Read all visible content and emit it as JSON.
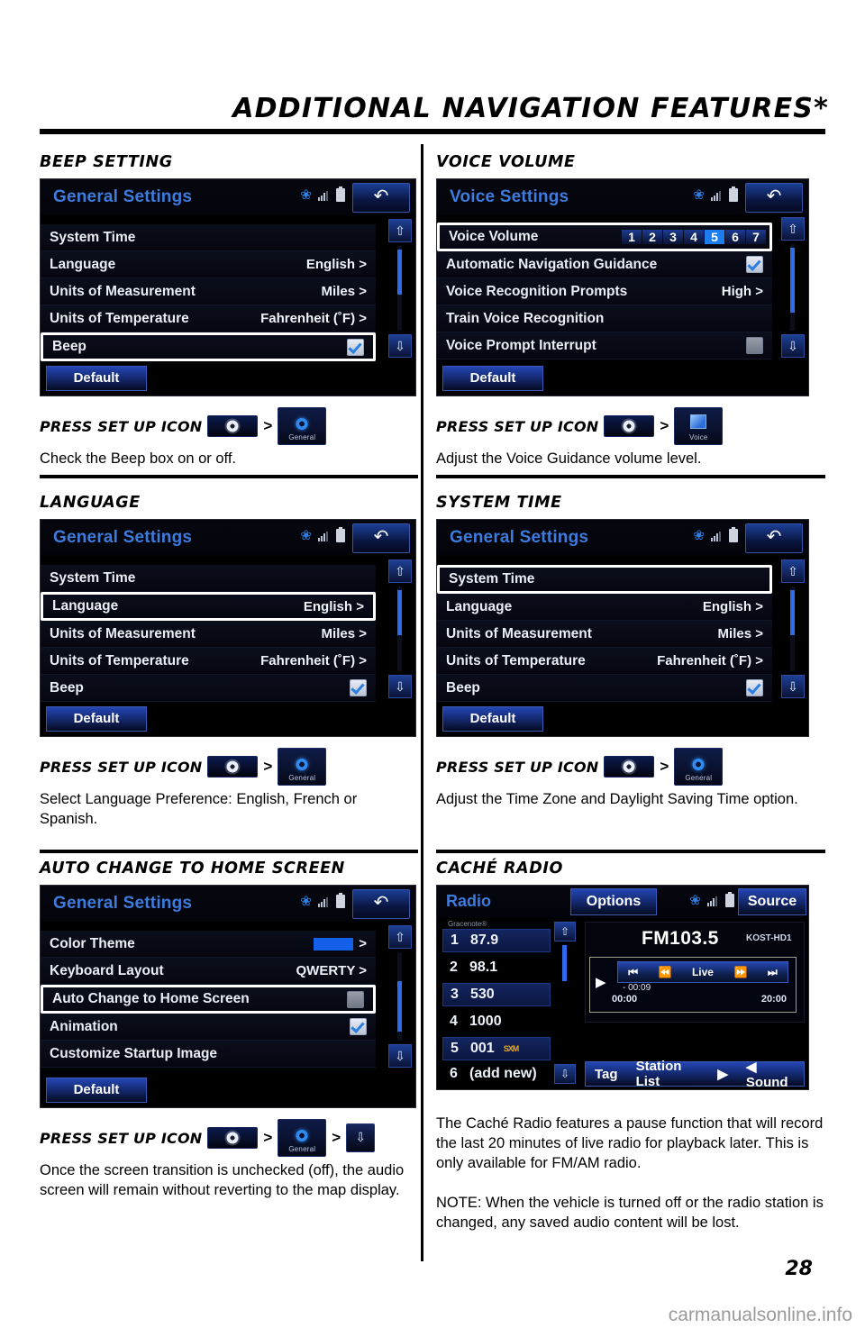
{
  "header": {
    "title": "ADDITIONAL NAVIGATION FEATURES*"
  },
  "footer": {
    "page_number": "28",
    "watermark": "carmanualsonline.info"
  },
  "common": {
    "press_label": "PRESS SET UP ICON",
    "chevron": ">",
    "setup_icon_name": "gear-icon",
    "default_button": "Default",
    "scroll_up": "↑",
    "scroll_down": "↓"
  },
  "sections": {
    "beep": {
      "heading": "BEEP SETTING",
      "screen": {
        "title": "General Settings",
        "rows": [
          {
            "label": "System Time",
            "value": "",
            "control": "none",
            "highlight": false
          },
          {
            "label": "Language",
            "value": "English >",
            "control": "none",
            "highlight": false
          },
          {
            "label": "Units of Measurement",
            "value": "Miles >",
            "control": "none",
            "highlight": false
          },
          {
            "label": "Units of Temperature",
            "value": "Fahrenheit (˚F) >",
            "control": "none",
            "highlight": false
          },
          {
            "label": "Beep",
            "value": "",
            "control": "check-on",
            "highlight": true
          }
        ]
      },
      "tiles": [
        {
          "label": "General",
          "icon": "sun-gear-icon"
        }
      ],
      "description": "Check the Beep box on or off."
    },
    "voice": {
      "heading": "VOICE VOLUME",
      "screen": {
        "title": "Voice Settings",
        "volume_label": "Voice Volume",
        "volume_options": [
          "1",
          "2",
          "3",
          "4",
          "5",
          "6",
          "7"
        ],
        "volume_selected": "5",
        "rows": [
          {
            "label": "Automatic Navigation Guidance",
            "value": "",
            "control": "check-on",
            "highlight": false
          },
          {
            "label": "Voice Recognition Prompts",
            "value": "High >",
            "control": "none",
            "highlight": false
          },
          {
            "label": "Train Voice Recognition",
            "value": "",
            "control": "none",
            "highlight": false
          },
          {
            "label": "Voice Prompt Interrupt",
            "value": "",
            "control": "check-off",
            "highlight": false
          }
        ]
      },
      "tiles": [
        {
          "label": "Voice",
          "icon": "voice-icon"
        }
      ],
      "description": "Adjust the Voice Guidance volume level."
    },
    "language": {
      "heading": "LANGUAGE",
      "screen": {
        "title": "General Settings",
        "rows": [
          {
            "label": "System Time",
            "value": "",
            "control": "none",
            "highlight": false
          },
          {
            "label": "Language",
            "value": "English >",
            "control": "none",
            "highlight": true
          },
          {
            "label": "Units of Measurement",
            "value": "Miles >",
            "control": "none",
            "highlight": false
          },
          {
            "label": "Units of Temperature",
            "value": "Fahrenheit (˚F) >",
            "control": "none",
            "highlight": false
          },
          {
            "label": "Beep",
            "value": "",
            "control": "check-on",
            "highlight": false
          }
        ]
      },
      "tiles": [
        {
          "label": "General",
          "icon": "sun-gear-icon"
        }
      ],
      "description": "Select Language Preference: English, French or Spanish."
    },
    "system_time": {
      "heading": "SYSTEM TIME",
      "screen": {
        "title": "General Settings",
        "rows": [
          {
            "label": "System Time",
            "value": "",
            "control": "none",
            "highlight": true
          },
          {
            "label": "Language",
            "value": "English >",
            "control": "none",
            "highlight": false
          },
          {
            "label": "Units of Measurement",
            "value": "Miles >",
            "control": "none",
            "highlight": false
          },
          {
            "label": "Units of Temperature",
            "value": "Fahrenheit (˚F) >",
            "control": "none",
            "highlight": false
          },
          {
            "label": "Beep",
            "value": "",
            "control": "check-on",
            "highlight": false
          }
        ]
      },
      "tiles": [
        {
          "label": "General",
          "icon": "sun-gear-icon"
        }
      ],
      "description": "Adjust the Time Zone and Daylight Saving Time option."
    },
    "auto_home": {
      "heading": "AUTO CHANGE TO HOME SCREEN",
      "screen": {
        "title": "General Settings",
        "rows": [
          {
            "label": "Color Theme",
            "value": ">",
            "control": "swatch",
            "highlight": false
          },
          {
            "label": "Keyboard Layout",
            "value": "QWERTY >",
            "control": "none",
            "highlight": false
          },
          {
            "label": "Auto Change to Home Screen",
            "value": "",
            "control": "check-off",
            "highlight": true
          },
          {
            "label": "Animation",
            "value": "",
            "control": "check-on",
            "highlight": false
          },
          {
            "label": "Customize Startup Image",
            "value": "",
            "control": "none",
            "highlight": false
          }
        ]
      },
      "tiles": [
        {
          "label": "General",
          "icon": "sun-gear-icon"
        },
        {
          "label": "",
          "icon": "down-arrow-icon"
        }
      ],
      "description": "Once the screen transition is unchecked (off), the audio screen will remain without reverting to the map display."
    },
    "cache_radio": {
      "heading": "CACHÉ RADIO",
      "screen": {
        "title": "Radio",
        "options_button": "Options",
        "source_button": "Source",
        "gracenote": "Gracenote®",
        "presets": [
          {
            "num": "1",
            "value": "87.9",
            "badge": "",
            "selected": true
          },
          {
            "num": "2",
            "value": "98.1",
            "badge": "",
            "selected": false
          },
          {
            "num": "3",
            "value": "530",
            "badge": "",
            "selected": true
          },
          {
            "num": "4",
            "value": "1000",
            "badge": "",
            "selected": false
          },
          {
            "num": "5",
            "value": "001",
            "badge": "SXM",
            "selected": true
          },
          {
            "num": "6",
            "value": "(add new)",
            "badge": "",
            "selected": false
          }
        ],
        "frequency": "FM103.5",
        "callsign": "KOST-HD1",
        "transport": [
          "⏮",
          "⏪",
          "Live",
          "⏩",
          "⏭"
        ],
        "elapsed": "- 00:09",
        "time_start": "00:00",
        "time_end": "20:00",
        "bottom_buttons": [
          "Tag",
          "Station List",
          "▶",
          "◀ Sound"
        ]
      },
      "paragraphs": [
        "The Caché Radio features a pause function that will record the last 20 minutes of live radio for playback later. This is only available for FM/AM radio.",
        "NOTE: When the vehicle is turned off or the radio station is changed, any saved audio content will be lost."
      ]
    }
  }
}
